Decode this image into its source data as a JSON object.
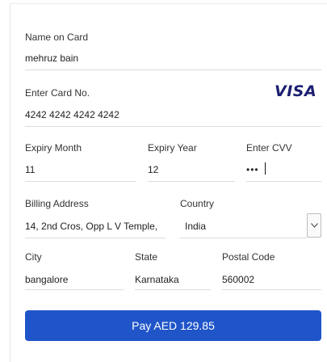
{
  "form": {
    "name_on_card": {
      "label": "Name on Card",
      "value": "mehruz bain"
    },
    "card_number": {
      "label": "Enter Card No.",
      "value": "4242 4242 4242 4242",
      "brand": "VISA"
    },
    "expiry_month": {
      "label": "Expiry Month",
      "value": "11"
    },
    "expiry_year": {
      "label": "Expiry Year",
      "value": "12"
    },
    "cvv": {
      "label": "Enter CVV",
      "masked_value": "•••"
    },
    "billing_address": {
      "label": "Billing Address",
      "value": "14, 2nd Cros, Opp L V Temple,"
    },
    "country": {
      "label": "Country",
      "selected": "India"
    },
    "city": {
      "label": "City",
      "value": "bangalore"
    },
    "state": {
      "label": "State",
      "value": "Karnataka"
    },
    "postal_code": {
      "label": "Postal Code",
      "value": "560002"
    }
  },
  "pay_button": {
    "label": "Pay AED 129.85"
  },
  "colors": {
    "pay_button_bg": "#1f55c8",
    "visa_blue": "#1a1f71",
    "underline": "#dcdcdc"
  },
  "icons": {
    "select_arrow": "chevron-down-icon",
    "brand_logo": "visa-logo"
  }
}
